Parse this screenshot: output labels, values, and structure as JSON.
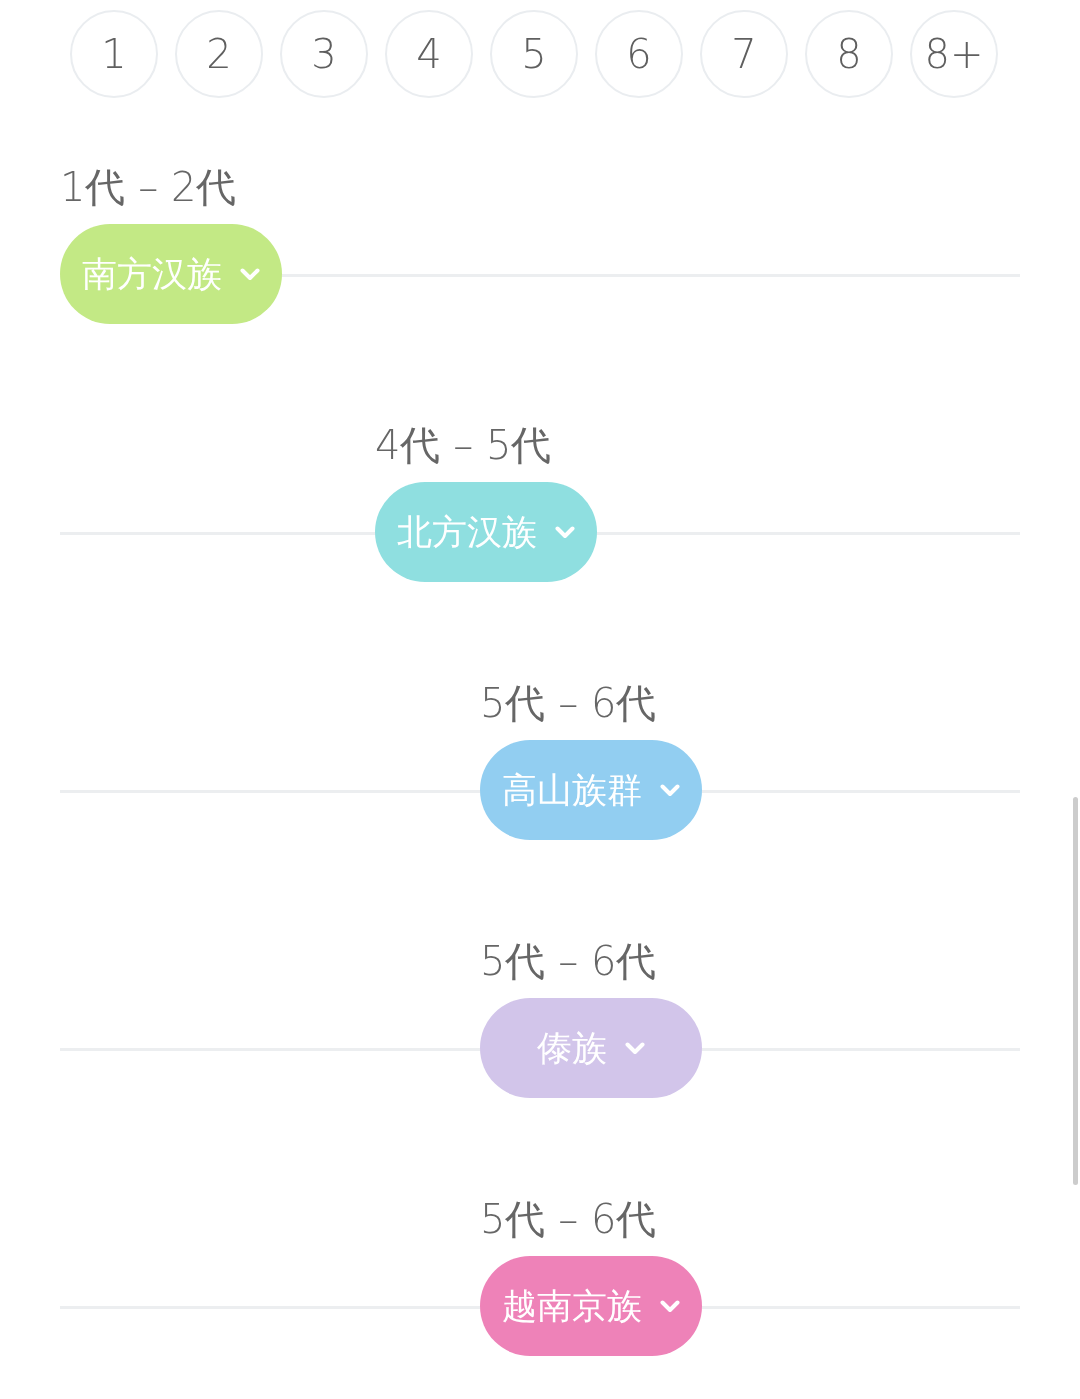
{
  "count_options": [
    {
      "label": "1",
      "selected": false
    },
    {
      "label": "2",
      "selected": false
    },
    {
      "label": "3",
      "selected": false
    },
    {
      "label": "4",
      "selected": false
    },
    {
      "label": "5",
      "selected": false
    },
    {
      "label": "6",
      "selected": false
    },
    {
      "label": "7",
      "selected": false
    },
    {
      "label": "8",
      "selected": false
    },
    {
      "label": "8+",
      "selected": false
    }
  ],
  "rows": [
    {
      "range": "1代 – 2代",
      "group": "南方汉族",
      "color": "#c3e985"
    },
    {
      "range": "4代 – 5代",
      "group": "北方汉族",
      "color": "#8fdfe0"
    },
    {
      "range": "5代 – 6代",
      "group": "高山族群",
      "color": "#92cef1"
    },
    {
      "range": "5代 – 6代",
      "group": "傣族",
      "color": "#d2c5ea"
    },
    {
      "range": "5代 – 6代",
      "group": "越南京族",
      "color": "#ee82b8"
    }
  ]
}
